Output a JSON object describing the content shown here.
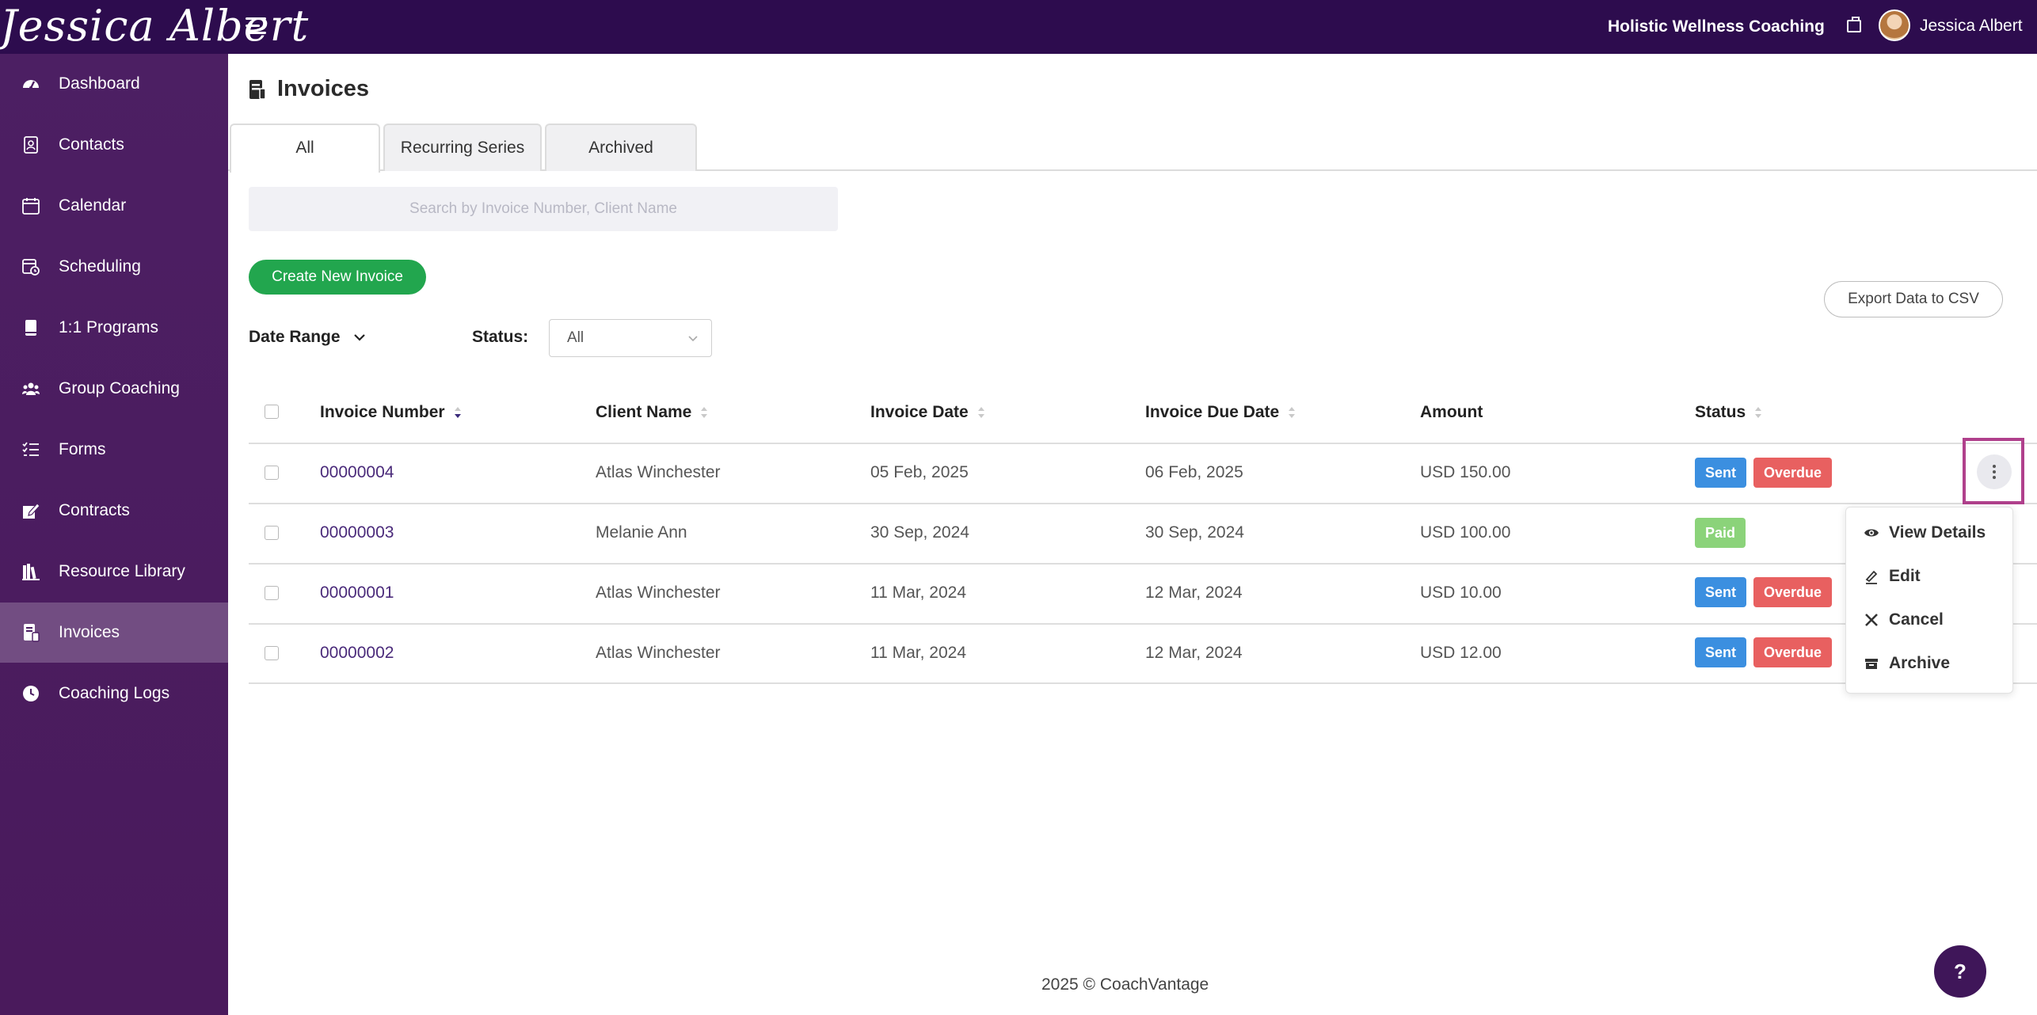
{
  "header": {
    "logo_text": "Jessica Albert",
    "business_name": "Holistic Wellness Coaching",
    "user_name": "Jessica Albert"
  },
  "sidebar": {
    "items": [
      {
        "label": "Dashboard",
        "icon": "dashboard-icon"
      },
      {
        "label": "Contacts",
        "icon": "contacts-icon"
      },
      {
        "label": "Calendar",
        "icon": "calendar-icon"
      },
      {
        "label": "Scheduling",
        "icon": "scheduling-icon"
      },
      {
        "label": "1:1 Programs",
        "icon": "book-icon"
      },
      {
        "label": "Group Coaching",
        "icon": "group-icon"
      },
      {
        "label": "Forms",
        "icon": "checklist-icon"
      },
      {
        "label": "Contracts",
        "icon": "contract-icon"
      },
      {
        "label": "Resource Library",
        "icon": "library-icon"
      },
      {
        "label": "Invoices",
        "icon": "invoice-icon",
        "active": true
      },
      {
        "label": "Coaching Logs",
        "icon": "clock-icon"
      }
    ]
  },
  "page": {
    "title": "Invoices",
    "tabs": [
      "All",
      "Recurring Series",
      "Archived"
    ],
    "active_tab": "All",
    "search_placeholder": "Search by Invoice Number, Client Name",
    "create_button": "Create New Invoice",
    "export_button": "Export Data to CSV",
    "date_range_label": "Date Range",
    "status_label": "Status:",
    "status_value": "All"
  },
  "table": {
    "columns": [
      "Invoice Number",
      "Client Name",
      "Invoice Date",
      "Invoice Due Date",
      "Amount",
      "Status"
    ],
    "rows": [
      {
        "number": "00000004",
        "client": "Atlas Winchester",
        "date": "05 Feb, 2025",
        "due": "06 Feb, 2025",
        "amount": "USD 150.00",
        "statuses": [
          "Sent",
          "Overdue"
        ]
      },
      {
        "number": "00000003",
        "client": "Melanie Ann",
        "date": "30 Sep, 2024",
        "due": "30 Sep, 2024",
        "amount": "USD 100.00",
        "statuses": [
          "Paid"
        ]
      },
      {
        "number": "00000001",
        "client": "Atlas Winchester",
        "date": "11 Mar, 2024",
        "due": "12 Mar, 2024",
        "amount": "USD 10.00",
        "statuses": [
          "Sent",
          "Overdue"
        ]
      },
      {
        "number": "00000002",
        "client": "Atlas Winchester",
        "date": "11 Mar, 2024",
        "due": "12 Mar, 2024",
        "amount": "USD 12.00",
        "statuses": [
          "Sent",
          "Overdue"
        ]
      }
    ]
  },
  "row_menu": {
    "items": [
      "View Details",
      "Edit",
      "Cancel",
      "Archive"
    ]
  },
  "footer": {
    "text": "2025 © CoachVantage",
    "help_label": "?"
  },
  "colors": {
    "topbar": "#2d0c4e",
    "sidebar": "#4c1f63",
    "accent_green": "#22a64e",
    "badge_sent": "#3b8fe0",
    "badge_overdue": "#e86060",
    "badge_paid": "#8bd37a",
    "highlight": "#b0408c"
  }
}
